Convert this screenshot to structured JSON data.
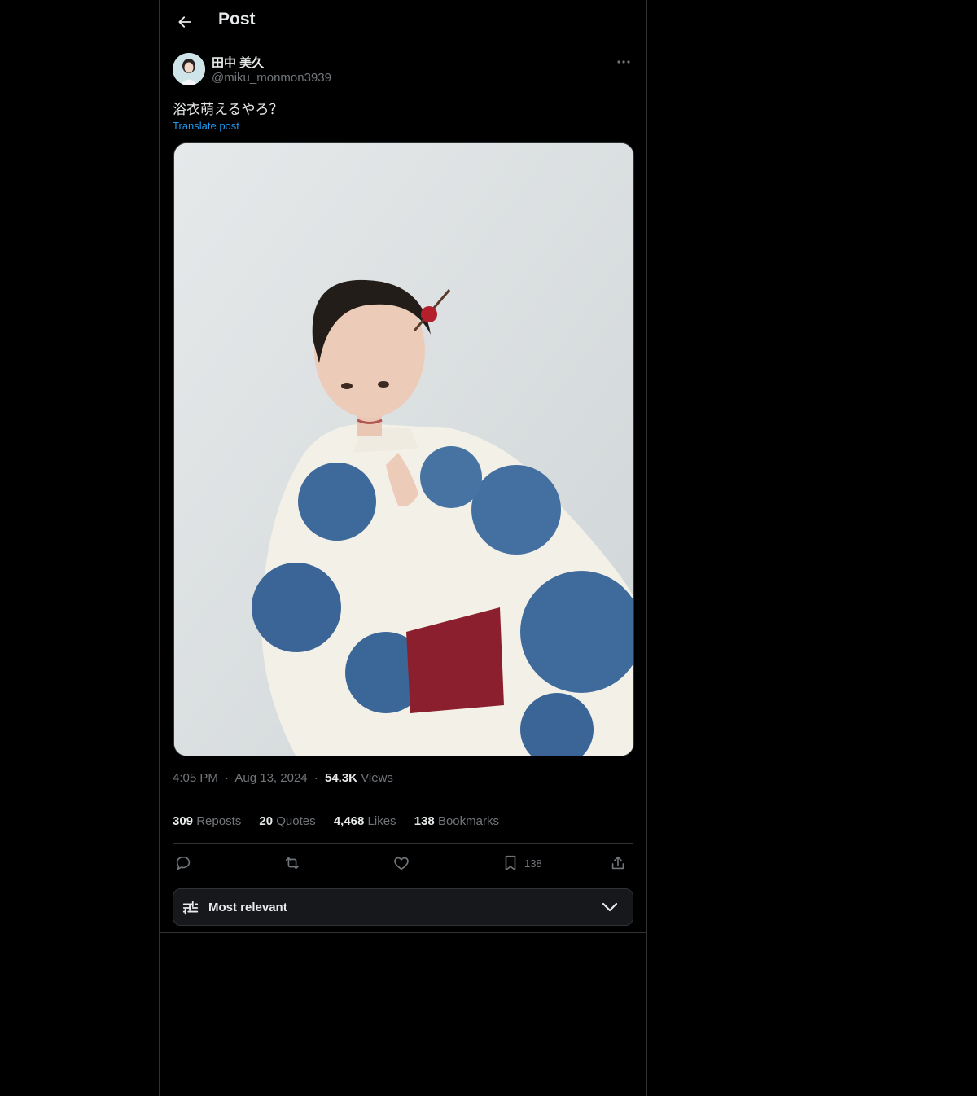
{
  "header": {
    "title": "Post"
  },
  "author": {
    "display_name": "田中 美久",
    "handle": "@miku_monmon3939"
  },
  "post": {
    "text": "浴衣萌えるやろ？",
    "translate_label": "Translate post",
    "time": "4:05 PM",
    "date": "Aug 13, 2024",
    "views_count": "54.3K",
    "views_label": "Views",
    "dot": "·"
  },
  "stats": [
    {
      "count": "309",
      "label": "Reposts"
    },
    {
      "count": "20",
      "label": "Quotes"
    },
    {
      "count": "4,468",
      "label": "Likes"
    },
    {
      "count": "138",
      "label": "Bookmarks"
    }
  ],
  "actions": {
    "bookmark_count": "138",
    "icons": [
      "reply-icon",
      "repost-icon",
      "like-icon",
      "bookmark-icon",
      "share-icon"
    ]
  },
  "sort": {
    "label": "Most relevant"
  },
  "colors": {
    "background": "#000000",
    "text": "#e7e9ea",
    "muted": "#71767b",
    "link": "#1d9bf0",
    "border": "#2f3336",
    "sort_bg": "#16181c"
  }
}
